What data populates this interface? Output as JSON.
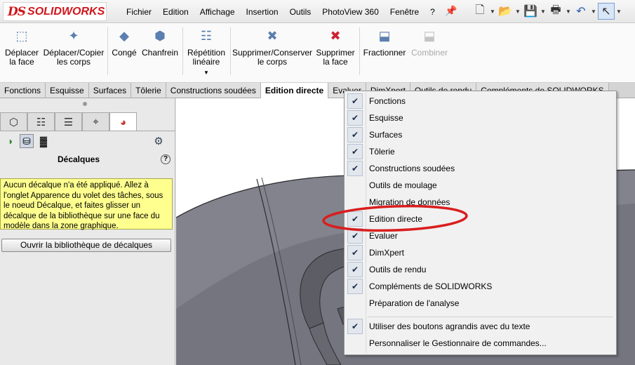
{
  "app": {
    "logo_ds": "DS",
    "logo_text": "SOLIDWORKS"
  },
  "menu": [
    "Fichier",
    "Edition",
    "Affichage",
    "Insertion",
    "Outils",
    "PhotoView 360",
    "Fenêtre",
    "?"
  ],
  "ribbon": {
    "move_face": "Déplacer la face",
    "move_copy_bodies": "Déplacer/Copier les corps",
    "fillet": "Congé",
    "chamfer": "Chanfrein",
    "linear_pattern": "Répétition linéaire",
    "delete_keep_body": "Supprimer/Conserver le corps",
    "delete_face": "Supprimer la face",
    "split": "Fractionner",
    "combine": "Combiner"
  },
  "tabs": [
    "Fonctions",
    "Esquisse",
    "Surfaces",
    "Tôlerie",
    "Constructions soudées",
    "Edition directe",
    "Evaluer",
    "DimXpert",
    "Outils de rendu",
    "Compléments de SOLIDWORKS"
  ],
  "panel": {
    "title": "Décalques",
    "help": "?",
    "note": "Aucun décalque n'a été appliqué. Allez à l'onglet Apparence du volet des tâches, sous le noeud Décalque, et faites glisser un décalque de la bibliothèque sur une face du modèle dans la zone graphique.",
    "open_library": "Ouvrir la bibliothèque de décalques"
  },
  "context_menu": {
    "items": [
      {
        "label": "Fonctions",
        "checked": "✔"
      },
      {
        "label": "Esquisse",
        "checked": "✔"
      },
      {
        "label": "Surfaces",
        "checked": "✔"
      },
      {
        "label": "Tôlerie",
        "checked": "✔"
      },
      {
        "label": "Constructions soudées",
        "checked": "✔"
      },
      {
        "label": "Outils de moulage",
        "checked": ""
      },
      {
        "label": "Migration de données",
        "checked": ""
      },
      {
        "label": "Edition directe",
        "checked": "✔"
      },
      {
        "label": "Evaluer",
        "checked": "✔"
      },
      {
        "label": "DimXpert",
        "checked": "✔"
      },
      {
        "label": "Outils de rendu",
        "checked": "✔"
      },
      {
        "label": "Compléments de SOLIDWORKS",
        "checked": "✔"
      },
      {
        "label": "Préparation de l'analyse",
        "checked": ""
      }
    ],
    "large_buttons": {
      "label": "Utiliser des boutons agrandis avec du texte",
      "checked": "✔"
    },
    "customize": "Personnaliser le Gestionnaire de commandes...",
    "highlight_color": "#d91e1e"
  },
  "colors": {
    "model_face": "#6f7079",
    "model_dark": "#5a5b63",
    "note_bg": "#ffff8f"
  }
}
